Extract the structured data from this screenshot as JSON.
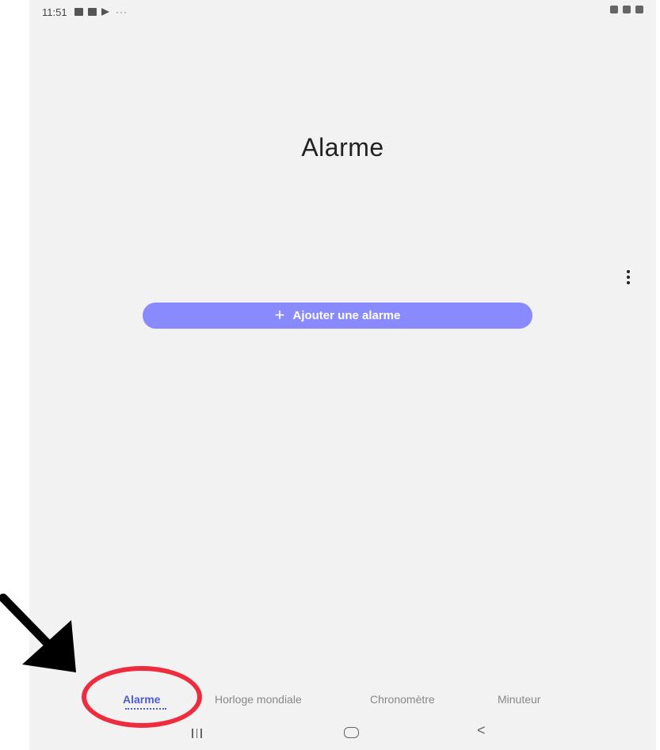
{
  "status_bar": {
    "time": "11:51",
    "left_icons": [
      "gallery-icon",
      "facebook-icon",
      "play-store-icon"
    ],
    "more": "···",
    "right_icons": [
      "mute-icon",
      "wifi-icon",
      "battery-icon"
    ]
  },
  "page": {
    "title": "Alarme"
  },
  "add_button": {
    "plus": "+",
    "label": "Ajouter une alarme"
  },
  "tabs": [
    {
      "label": "Alarme",
      "active": true
    },
    {
      "label": "Horloge mondiale",
      "active": false
    },
    {
      "label": "Chronomètre",
      "active": false
    },
    {
      "label": "Minuteur",
      "active": false
    }
  ],
  "nav": {
    "back": "<"
  },
  "colors": {
    "accent": "#8a8aff",
    "active_tab": "#4f5bd5",
    "annotation_red": "#ef2b3e",
    "background": "#f2f2f2"
  }
}
